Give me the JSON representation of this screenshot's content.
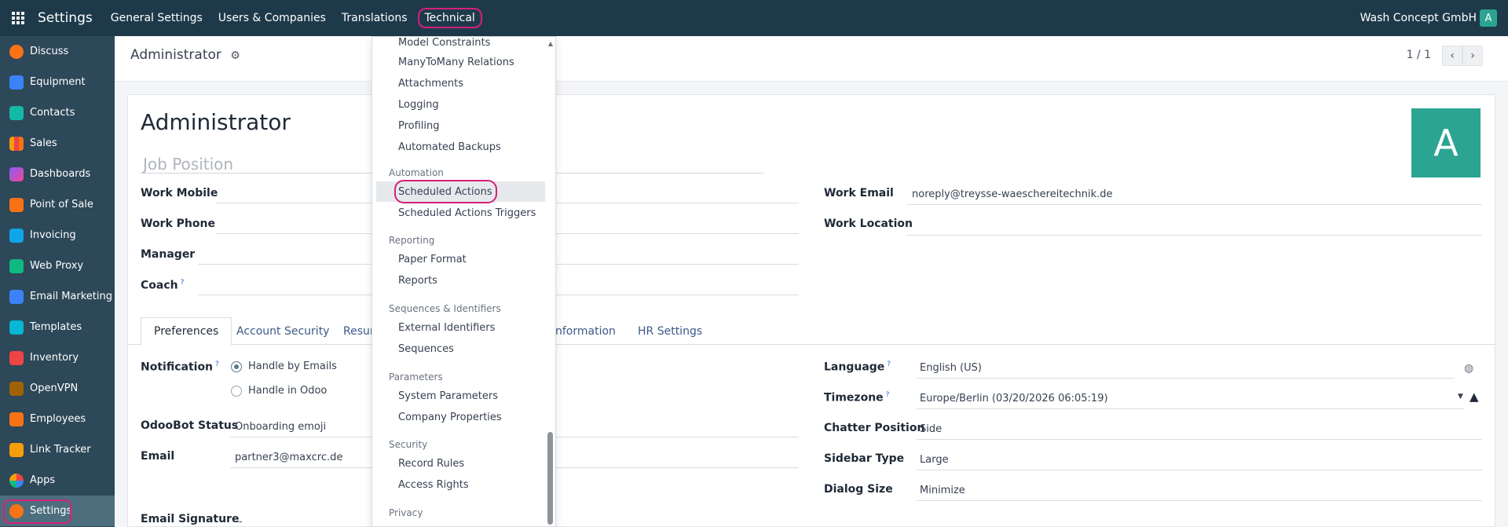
{
  "topbar": {
    "brand": "Settings",
    "menu": [
      "General Settings",
      "Users & Companies",
      "Translations",
      "Technical"
    ],
    "company": "Wash Concept GmbH",
    "user_initial": "A"
  },
  "sidebar": {
    "items": [
      {
        "label": "Discuss",
        "color": "#f97316"
      },
      {
        "label": "Equipment",
        "color": "#3b82f6"
      },
      {
        "label": "Contacts",
        "color": "#14b8a6"
      },
      {
        "label": "Sales",
        "color": "#f59e0b"
      },
      {
        "label": "Dashboards",
        "color": "#8b5cf6"
      },
      {
        "label": "Point of Sale",
        "color": "#f97316"
      },
      {
        "label": "Invoicing",
        "color": "#0ea5e9"
      },
      {
        "label": "Web Proxy",
        "color": "#10b981"
      },
      {
        "label": "Email Marketing",
        "color": "#3b82f6"
      },
      {
        "label": "Templates",
        "color": "#06b6d4"
      },
      {
        "label": "Inventory",
        "color": "#ef4444"
      },
      {
        "label": "OpenVPN",
        "color": "#a16207"
      },
      {
        "label": "Employees",
        "color": "#f97316"
      },
      {
        "label": "Link Tracker",
        "color": "#f59e0b"
      },
      {
        "label": "Apps",
        "color": "#ef4444"
      },
      {
        "label": "Settings",
        "color": "#f97316"
      }
    ]
  },
  "control": {
    "breadcrumb": "Administrator",
    "pager": "1 / 1"
  },
  "form": {
    "name": "Administrator",
    "job_placeholder": "Job Position",
    "avatar_initial": "A",
    "labels": {
      "work_mobile": "Work Mobile",
      "work_phone": "Work Phone",
      "manager": "Manager",
      "coach": "Coach",
      "work_email": "Work Email",
      "work_location": "Work Location"
    },
    "values": {
      "work_email": "noreply@treysse-waeschereitechnik.de"
    },
    "tabs": [
      "Preferences",
      "Account Security",
      "Resun",
      "nformation",
      "HR Settings"
    ],
    "prefs": {
      "notification_label": "Notification",
      "notification_opt1": "Handle by Emails",
      "notification_opt2": "Handle in Odoo",
      "odoobot_label": "OdooBot Status",
      "odoobot_value": "Onboarding emoji",
      "email_label": "Email",
      "email_value": "partner3@maxcrc.de",
      "signature_label": "Email Signature",
      "signature_value": "--",
      "language_label": "Language",
      "language_value": "English (US)",
      "timezone_label": "Timezone",
      "timezone_value": "Europe/Berlin (03/20/2026 06:05:19)",
      "chatter_label": "Chatter Position",
      "chatter_value": "Side",
      "sidebar_label": "Sidebar Type",
      "sidebar_value": "Large",
      "dialog_label": "Dialog Size",
      "dialog_value": "Minimize"
    }
  },
  "dropdown": {
    "items": {
      "model_constraints": "Model Constraints",
      "m2m": "ManyToMany Relations",
      "attachments": "Attachments",
      "logging": "Logging",
      "profiling": "Profiling",
      "backups": "Automated Backups",
      "automation_head": "Automation",
      "scheduled": "Scheduled Actions",
      "scheduled_triggers": "Scheduled Actions Triggers",
      "reporting_head": "Reporting",
      "paper": "Paper Format",
      "reports": "Reports",
      "sequences_head": "Sequences & Identifiers",
      "external_ids": "External Identifiers",
      "sequences": "Sequences",
      "parameters_head": "Parameters",
      "system_params": "System Parameters",
      "company_props": "Company Properties",
      "security_head": "Security",
      "record_rules": "Record Rules",
      "access_rights": "Access Rights",
      "privacy_head": "Privacy"
    }
  },
  "colors": {
    "topbar": "#1e3a4a",
    "sidebar": "#2d4858",
    "highlight": "#d6207a",
    "avatar": "#2ba491"
  }
}
